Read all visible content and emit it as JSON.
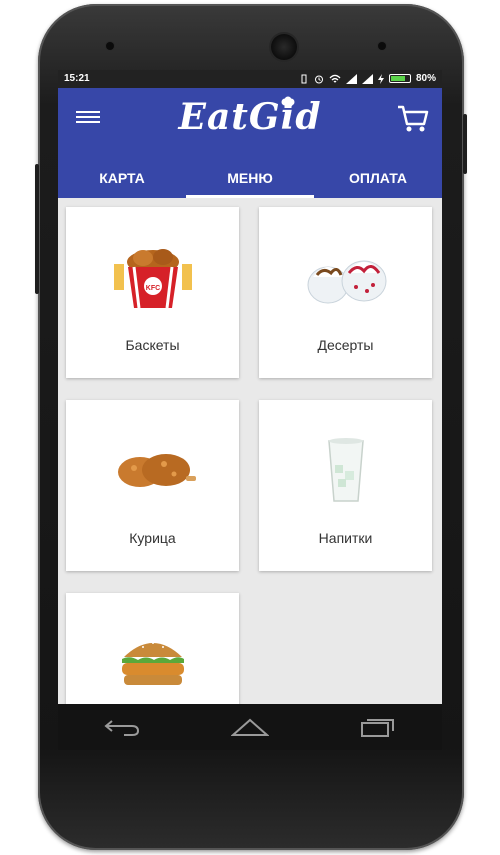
{
  "status": {
    "time": "15:21",
    "battery": "80%",
    "battery_level": 0.8
  },
  "app": {
    "logo_text": "EatGid"
  },
  "tabs": [
    {
      "label": "КАРТА",
      "active": false
    },
    {
      "label": "МЕНЮ",
      "active": true
    },
    {
      "label": "ОПЛАТА",
      "active": false
    }
  ],
  "menu": {
    "items": [
      {
        "label": "Баскеты",
        "icon": "bucket-icon"
      },
      {
        "label": "Десерты",
        "icon": "dessert-icon"
      },
      {
        "label": "Курица",
        "icon": "chicken-icon"
      },
      {
        "label": "Напитки",
        "icon": "drink-icon"
      },
      {
        "label": "",
        "icon": "burger-icon"
      }
    ]
  },
  "colors": {
    "primary": "#3747a8",
    "background": "#e9e9e9",
    "card": "#ffffff"
  }
}
